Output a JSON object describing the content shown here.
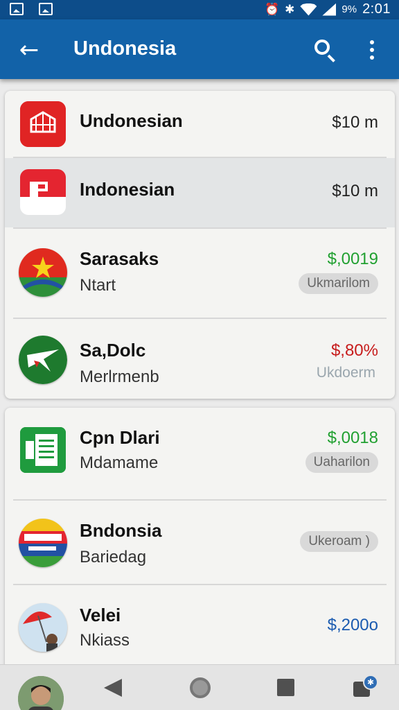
{
  "status_bar": {
    "battery_text": "9%",
    "time": "2:01",
    "icons": [
      "image-icon",
      "gallery-icon",
      "alarm-icon",
      "bluetooth-icon",
      "wifi-icon",
      "signal-icon"
    ]
  },
  "app_bar": {
    "title": "Undonesia",
    "icons": [
      "back-arrow-icon",
      "search-icon",
      "more-vertical-icon"
    ]
  },
  "list": [
    {
      "title": "Undonesian",
      "price": "$10 m",
      "icon": "web-app-icon"
    },
    {
      "title": "Indonesian",
      "price": "$10 m",
      "icon": "flag-app-icon",
      "selected": true
    },
    {
      "title": "Sarasaks",
      "subtitle": "Ntart",
      "price": "$,0019",
      "tag": "Ukmarilom",
      "icon": "star-emblem-icon"
    },
    {
      "title": "Sa,Dolc",
      "subtitle": "Merlrmenb",
      "price": "$,80%",
      "tag": "Ukdoerm",
      "icon": "star-badge-icon"
    },
    {
      "title": "Cpn Dlari",
      "subtitle": "Mdamame",
      "price": "$,0018",
      "tag": "Uaharilon",
      "icon": "sheets-icon"
    },
    {
      "title": "Bndonsia",
      "subtitle": "Bariedag",
      "tag": "Ukeroam )",
      "icon": "flag-circle-icon"
    },
    {
      "title": "Velei",
      "subtitle": "Nkiass",
      "price": "$,200o",
      "icon": "umbrella-photo-icon"
    }
  ],
  "colors": {
    "app_bar": "#1262a8",
    "status_bar": "#0d4d8a",
    "price_green": "#21a031",
    "price_red": "#c71c1c",
    "price_blue": "#1b5bb0"
  },
  "nav_bar": {
    "icons": [
      "avatar",
      "nav-back-icon",
      "nav-home-icon",
      "nav-recent-icon",
      "notification-app-icon"
    ]
  }
}
